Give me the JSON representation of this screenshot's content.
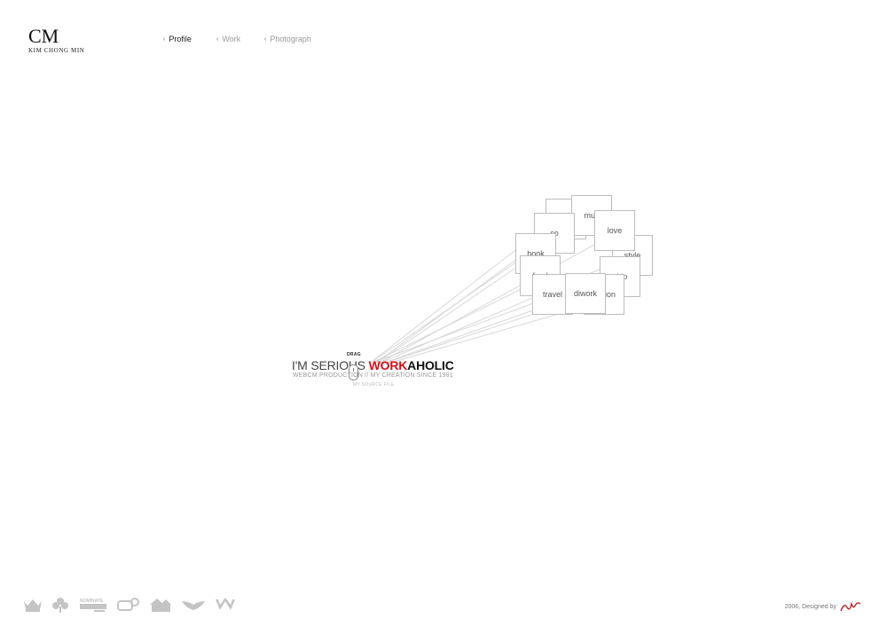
{
  "logo": {
    "mark": "CM",
    "name": "KIM CHONG MIN"
  },
  "nav": [
    {
      "label": "Profile",
      "active": true
    },
    {
      "label": "Work",
      "active": false
    },
    {
      "label": "Photograph",
      "active": false
    }
  ],
  "nav_arrow": "‹",
  "cards": [
    "came",
    "mus",
    "co",
    "love",
    "book",
    "style",
    "food",
    "ship",
    "travel",
    "diwork",
    "lection"
  ],
  "hero": {
    "drag_label": "DRAG",
    "headline_prefix": "I'M SERIOUS ",
    "headline_work": "WORK",
    "headline_aholic": "AHOLIC",
    "subline": "WEBCM PRODUCTION // MY CREATION SINCE 1981",
    "sourceline": "MY SOURCE FILE"
  },
  "footer": {
    "icons": [
      "crown-icon",
      "flower-icon",
      "nominate-award-icon",
      "badge-icon",
      "house-icon",
      "wing-icon",
      "w-logo-icon"
    ],
    "nominate_text": "NOMINATE",
    "credit": "2006, Designed by"
  },
  "colors": {
    "accent": "#d4111b",
    "text": "#444444",
    "muted": "#999999",
    "footer_icon": "#bbbbbb"
  }
}
